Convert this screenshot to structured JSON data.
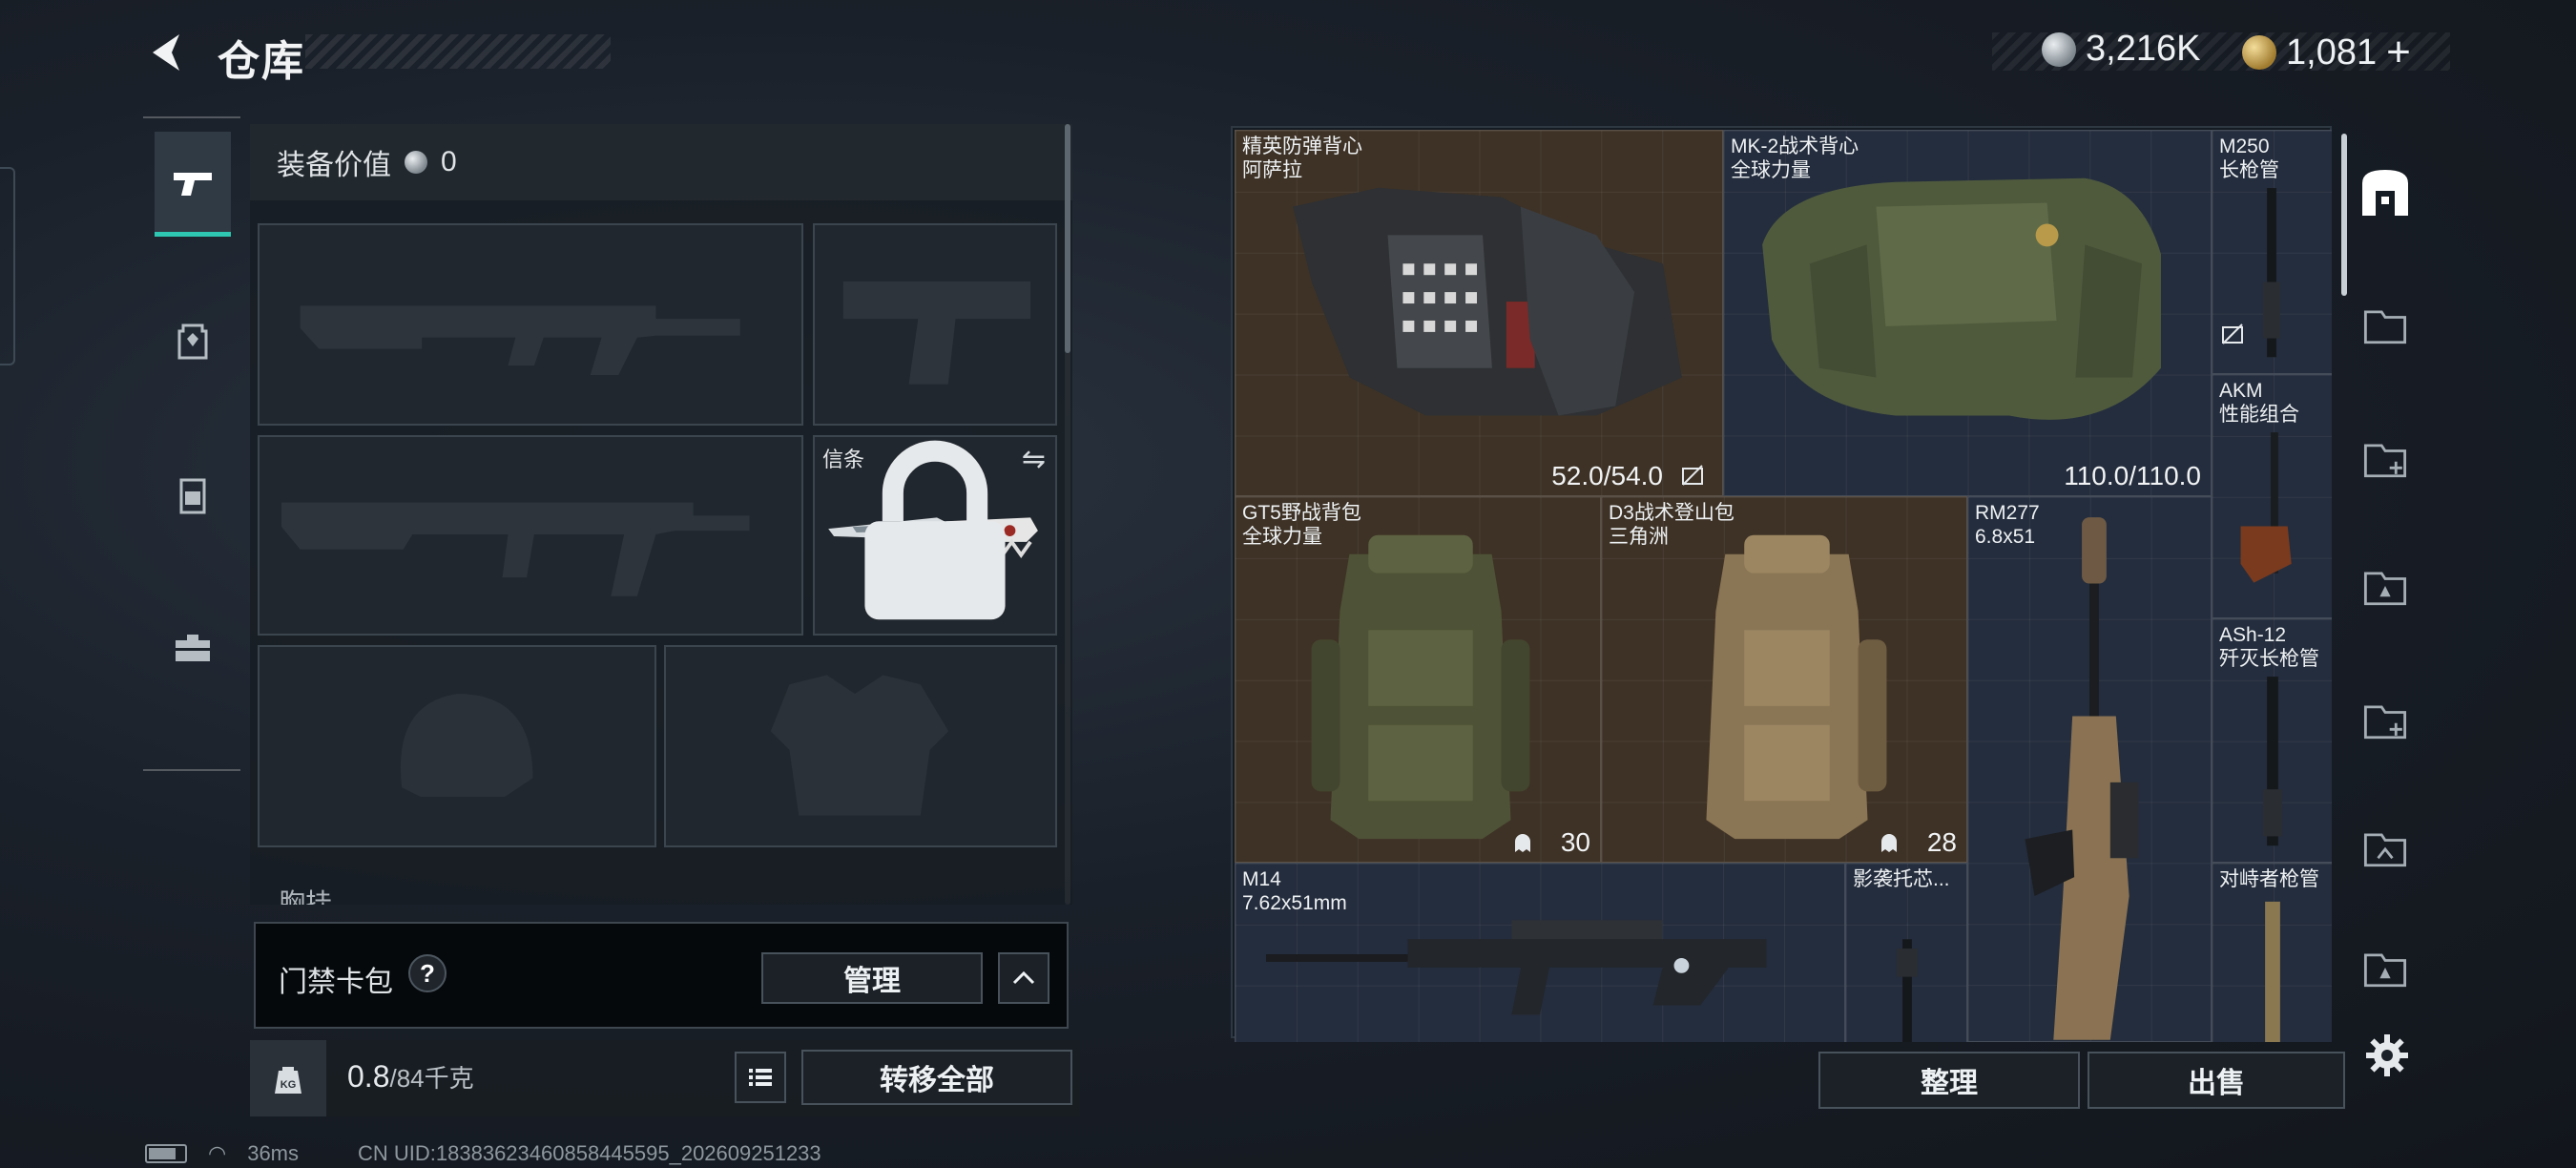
{
  "header": {
    "title": "仓库",
    "currency_silver": "3,216K",
    "currency_gold": "1,081",
    "add_symbol": "+"
  },
  "left_tabs": [
    {
      "icon": "pistol-icon",
      "active": true
    },
    {
      "icon": "backpack-tab-icon",
      "active": false
    },
    {
      "icon": "vest-tab-icon",
      "active": false
    },
    {
      "icon": "toolbox-tab-icon",
      "active": false
    }
  ],
  "equipment": {
    "value_label": "装备价值",
    "value": "0",
    "melee_label": "信条",
    "chest_label": "胸挂"
  },
  "cardpack": {
    "label": "门禁卡包",
    "help": "?",
    "manage": "管理",
    "collapse": "^"
  },
  "weight": {
    "current": "0.8",
    "max": "/84千克",
    "transfer_all": "转移全部"
  },
  "status": {
    "ping": "36ms",
    "uid": "CN UID:18383623460858445595_202609251233"
  },
  "stash_items": [
    {
      "key": "elite_vest",
      "name": "精英防弹背心\n阿萨拉",
      "value": "52.0/54.0"
    },
    {
      "key": "mk2_vest",
      "name": "MK-2战术背心\n全球力量",
      "value": "110.0/110.0"
    },
    {
      "key": "m250",
      "name": "M250\n长枪管"
    },
    {
      "key": "akm",
      "name": "AKM\n性能组合"
    },
    {
      "key": "gt5",
      "name": "GT5野战背包\n全球力量",
      "value": "30"
    },
    {
      "key": "d3",
      "name": "D3战术登山包\n三角洲",
      "value": "28"
    },
    {
      "key": "rm277",
      "name": "RM277\n6.8x51"
    },
    {
      "key": "ash12",
      "name": "ASh-12\n歼灭长枪管"
    },
    {
      "key": "m14",
      "name": "M14\n7.62x51mm"
    },
    {
      "key": "shadow",
      "name": "影袭托芯..."
    },
    {
      "key": "confront",
      "name": "对峙者枪管"
    }
  ],
  "actions": {
    "sort": "整理",
    "sell": "出售"
  },
  "colors": {
    "accent": "#2ec7b2",
    "brown_cell": "#3e3226",
    "blue_cell": "#242d3d"
  }
}
